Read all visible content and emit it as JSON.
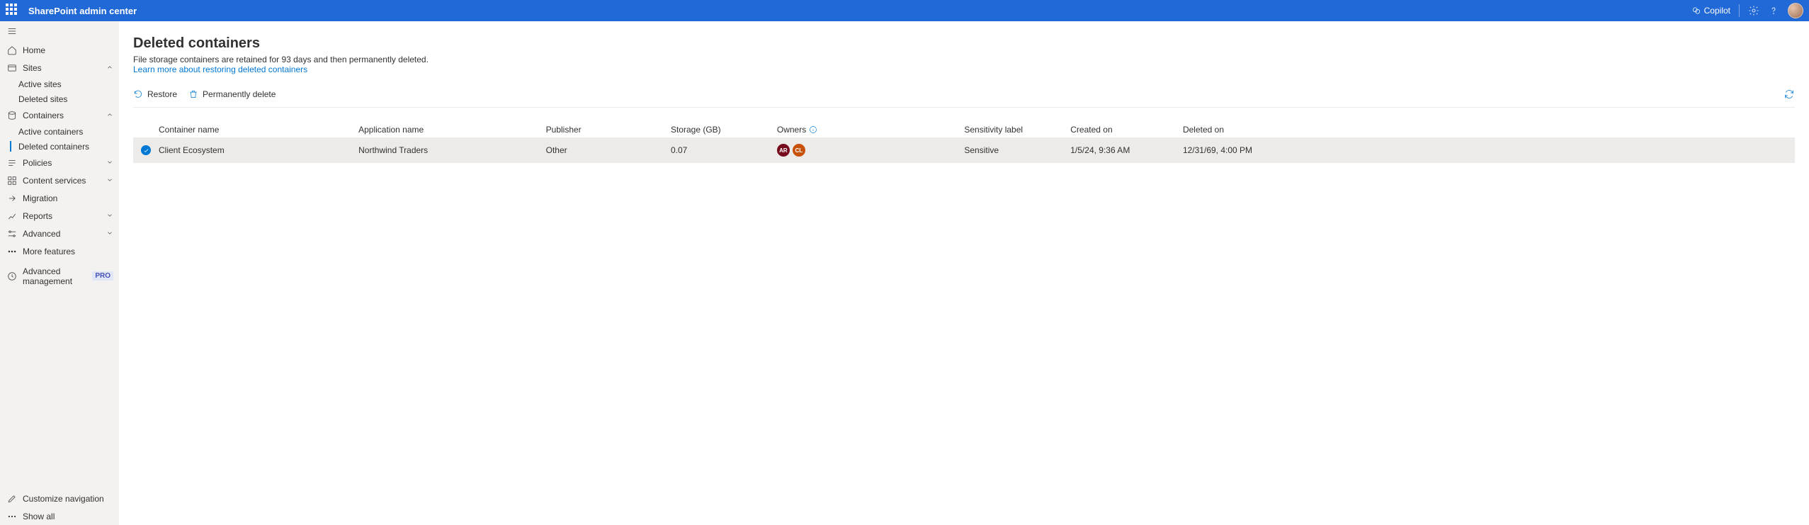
{
  "suite": {
    "title": "SharePoint admin center",
    "copilot_label": "Copilot"
  },
  "sidebar": {
    "home": "Home",
    "sites": {
      "label": "Sites",
      "active": "Active sites",
      "deleted": "Deleted sites"
    },
    "containers": {
      "label": "Containers",
      "active": "Active containers",
      "deleted": "Deleted containers"
    },
    "policies": "Policies",
    "content_services": "Content services",
    "migration": "Migration",
    "reports": "Reports",
    "advanced": "Advanced",
    "more_features": "More features",
    "advanced_management": "Advanced management",
    "pro_badge": "PRO",
    "customize_navigation": "Customize navigation",
    "show_all": "Show all"
  },
  "page": {
    "title": "Deleted containers",
    "description": "File storage containers are retained for 93 days and then permanently deleted.",
    "link": "Learn more about restoring deleted containers"
  },
  "commands": {
    "restore": "Restore",
    "perm_delete": "Permanently delete"
  },
  "table": {
    "headers": {
      "name": "Container name",
      "app": "Application name",
      "publisher": "Publisher",
      "storage": "Storage (GB)",
      "owners": "Owners",
      "sensitivity": "Sensitivity label",
      "created": "Created on",
      "deleted": "Deleted on"
    },
    "row": {
      "name": "Client Ecosystem",
      "app": "Northwind Traders",
      "publisher": "Other",
      "storage": "0.07",
      "owners": [
        "AR",
        "CL"
      ],
      "sensitivity": "Sensitive",
      "created": "1/5/24, 9:36 AM",
      "deleted": "12/31/69, 4:00 PM"
    }
  }
}
